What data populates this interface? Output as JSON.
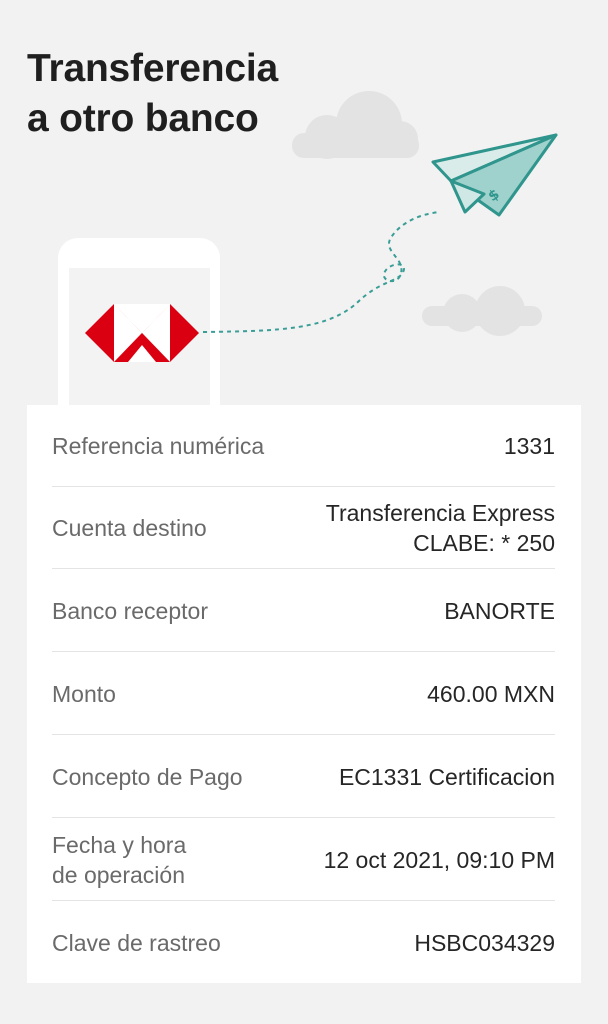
{
  "header": {
    "title_line1": "Transferencia",
    "title_line2": "a otro banco"
  },
  "illustration": {
    "icons": [
      "bank-logo-icon",
      "paper-plane-icon",
      "cloud-icon",
      "phone-icon"
    ],
    "colors": {
      "logo_red": "#db0011",
      "plane_teal": "#3a9e97",
      "plane_fill": "#cfe8e5",
      "cloud": "#e3e3e3"
    }
  },
  "details": {
    "rows": [
      {
        "label": [
          "Referencia numérica"
        ],
        "value": [
          "1331"
        ]
      },
      {
        "label": [
          "Cuenta destino"
        ],
        "value": [
          "Transferencia Express",
          "CLABE: * 250"
        ]
      },
      {
        "label": [
          "Banco receptor"
        ],
        "value": [
          "BANORTE"
        ]
      },
      {
        "label": [
          "Monto"
        ],
        "value": [
          "460.00 MXN"
        ]
      },
      {
        "label": [
          "Concepto de Pago"
        ],
        "value": [
          "EC1331 Certificacion"
        ]
      },
      {
        "label": [
          "Fecha y hora",
          "de operación"
        ],
        "value": [
          "12 oct 2021, 09:10 PM"
        ]
      },
      {
        "label": [
          "Clave de rastreo"
        ],
        "value": [
          "HSBC034329"
        ]
      }
    ]
  }
}
